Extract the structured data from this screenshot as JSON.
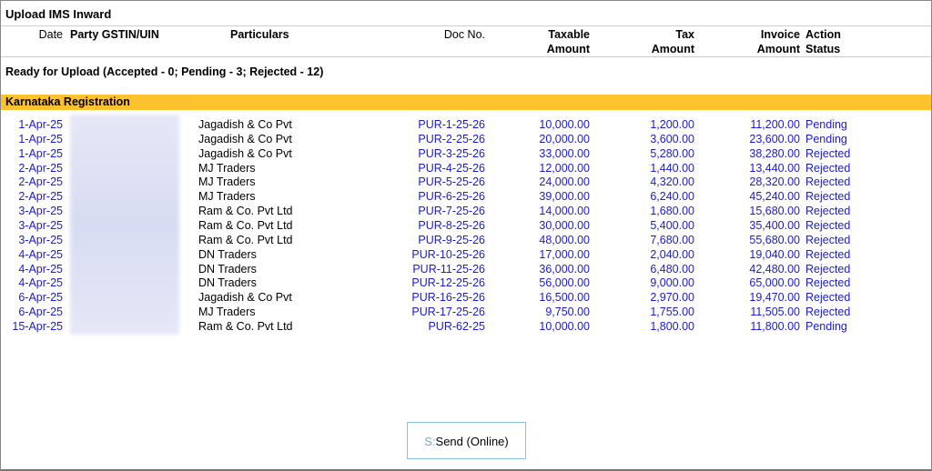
{
  "title": "Upload IMS Inward",
  "columns": {
    "date": "Date",
    "gstin": "Party GSTIN/UIN",
    "particulars": "Particulars",
    "doc_no": "Doc No.",
    "taxable1": "Taxable",
    "taxable2": "Amount",
    "tax1": "Tax",
    "tax2": "Amount",
    "invoice1": "Invoice",
    "invoice2": "Amount",
    "action1": "Action",
    "action2": "Status"
  },
  "summary": "Ready for Upload (Accepted - 0; Pending - 3; Rejected - 12)",
  "group": "Karnataka Registration",
  "rows": [
    {
      "date": "1-Apr-25",
      "party": "Jagadish & Co Pvt",
      "doc": "PUR-1-25-26",
      "taxable": "10,000.00",
      "tax": "1,200.00",
      "invoice": "11,200.00",
      "status": "Pending"
    },
    {
      "date": "1-Apr-25",
      "party": "Jagadish & Co Pvt",
      "doc": "PUR-2-25-26",
      "taxable": "20,000.00",
      "tax": "3,600.00",
      "invoice": "23,600.00",
      "status": "Pending"
    },
    {
      "date": "1-Apr-25",
      "party": "Jagadish & Co Pvt",
      "doc": "PUR-3-25-26",
      "taxable": "33,000.00",
      "tax": "5,280.00",
      "invoice": "38,280.00",
      "status": "Rejected"
    },
    {
      "date": "2-Apr-25",
      "party": "MJ Traders",
      "doc": "PUR-4-25-26",
      "taxable": "12,000.00",
      "tax": "1,440.00",
      "invoice": "13,440.00",
      "status": "Rejected"
    },
    {
      "date": "2-Apr-25",
      "party": "MJ Traders",
      "doc": "PUR-5-25-26",
      "taxable": "24,000.00",
      "tax": "4,320.00",
      "invoice": "28,320.00",
      "status": "Rejected"
    },
    {
      "date": "2-Apr-25",
      "party": "MJ Traders",
      "doc": "PUR-6-25-26",
      "taxable": "39,000.00",
      "tax": "6,240.00",
      "invoice": "45,240.00",
      "status": "Rejected"
    },
    {
      "date": "3-Apr-25",
      "party": "Ram & Co. Pvt Ltd",
      "doc": "PUR-7-25-26",
      "taxable": "14,000.00",
      "tax": "1,680.00",
      "invoice": "15,680.00",
      "status": "Rejected"
    },
    {
      "date": "3-Apr-25",
      "party": "Ram & Co. Pvt Ltd",
      "doc": "PUR-8-25-26",
      "taxable": "30,000.00",
      "tax": "5,400.00",
      "invoice": "35,400.00",
      "status": "Rejected"
    },
    {
      "date": "3-Apr-25",
      "party": "Ram & Co. Pvt Ltd",
      "doc": "PUR-9-25-26",
      "taxable": "48,000.00",
      "tax": "7,680.00",
      "invoice": "55,680.00",
      "status": "Rejected"
    },
    {
      "date": "4-Apr-25",
      "party": "DN Traders",
      "doc": "PUR-10-25-26",
      "taxable": "17,000.00",
      "tax": "2,040.00",
      "invoice": "19,040.00",
      "status": "Rejected"
    },
    {
      "date": "4-Apr-25",
      "party": "DN Traders",
      "doc": "PUR-11-25-26",
      "taxable": "36,000.00",
      "tax": "6,480.00",
      "invoice": "42,480.00",
      "status": "Rejected"
    },
    {
      "date": "4-Apr-25",
      "party": "DN Traders",
      "doc": "PUR-12-25-26",
      "taxable": "56,000.00",
      "tax": "9,000.00",
      "invoice": "65,000.00",
      "status": "Rejected"
    },
    {
      "date": "6-Apr-25",
      "party": "Jagadish & Co Pvt",
      "doc": "PUR-16-25-26",
      "taxable": "16,500.00",
      "tax": "2,970.00",
      "invoice": "19,470.00",
      "status": "Rejected"
    },
    {
      "date": "6-Apr-25",
      "party": "MJ Traders",
      "doc": "PUR-17-25-26",
      "taxable": "9,750.00",
      "tax": "1,755.00",
      "invoice": "11,505.00",
      "status": "Rejected"
    },
    {
      "date": "15-Apr-25",
      "party": "Ram & Co. Pvt Ltd",
      "doc": "PUR-62-25",
      "taxable": "10,000.00",
      "tax": "1,800.00",
      "invoice": "11,800.00",
      "status": "Pending"
    }
  ],
  "button": {
    "key": "S:",
    "label": "Send (Online)"
  }
}
